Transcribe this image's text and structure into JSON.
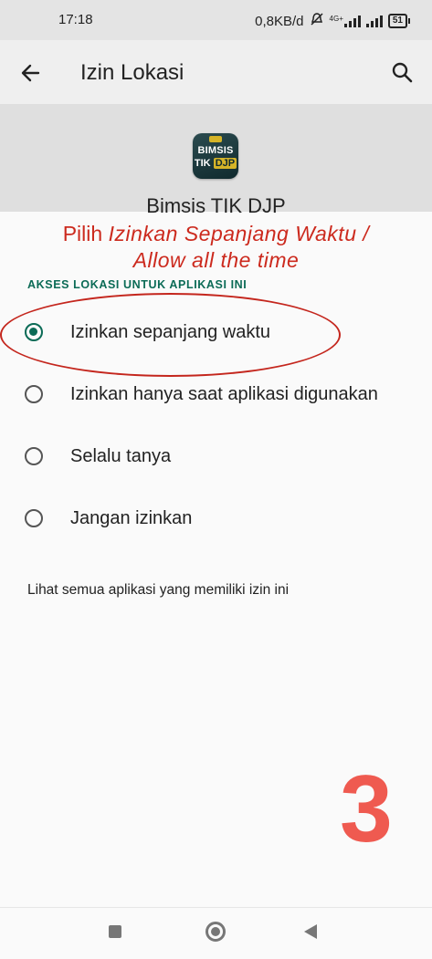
{
  "status_bar": {
    "time": "17:18",
    "net_speed": "0,8KB/d",
    "net_label": "4G+",
    "battery": "51"
  },
  "app_bar": {
    "title": "Izin Lokasi",
    "back_icon": "arrow-left-icon",
    "search_icon": "search-icon"
  },
  "app_info": {
    "icon_text_line1": "BIMSIS",
    "icon_text_line2a": "TIK",
    "icon_text_line2b": "DJP",
    "name": "Bimsis TIK DJP"
  },
  "instruction": {
    "prefix": "Pilih",
    "line1_italic": "Izinkan Sepanjang Waktu /",
    "line2_italic": "Allow all the time",
    "color": "#cc2a1e"
  },
  "section_label": "AKSES LOKASI UNTUK APLIKASI INI",
  "options": [
    {
      "label": "Izinkan sepanjang waktu",
      "selected": true
    },
    {
      "label": "Izinkan hanya saat aplikasi digunakan",
      "selected": false
    },
    {
      "label": "Selalu tanya",
      "selected": false
    },
    {
      "label": "Jangan izinkan",
      "selected": false
    }
  ],
  "view_all_link": "Lihat semua aplikasi yang memiliki izin ini",
  "step_number": "3",
  "colors": {
    "accent": "#0b6b56",
    "annotation": "#cc2a1e",
    "step_number": "#ef5a50"
  },
  "nav": {
    "recent_icon": "square-icon",
    "home_icon": "circle-icon",
    "back_icon": "triangle-back-icon"
  }
}
